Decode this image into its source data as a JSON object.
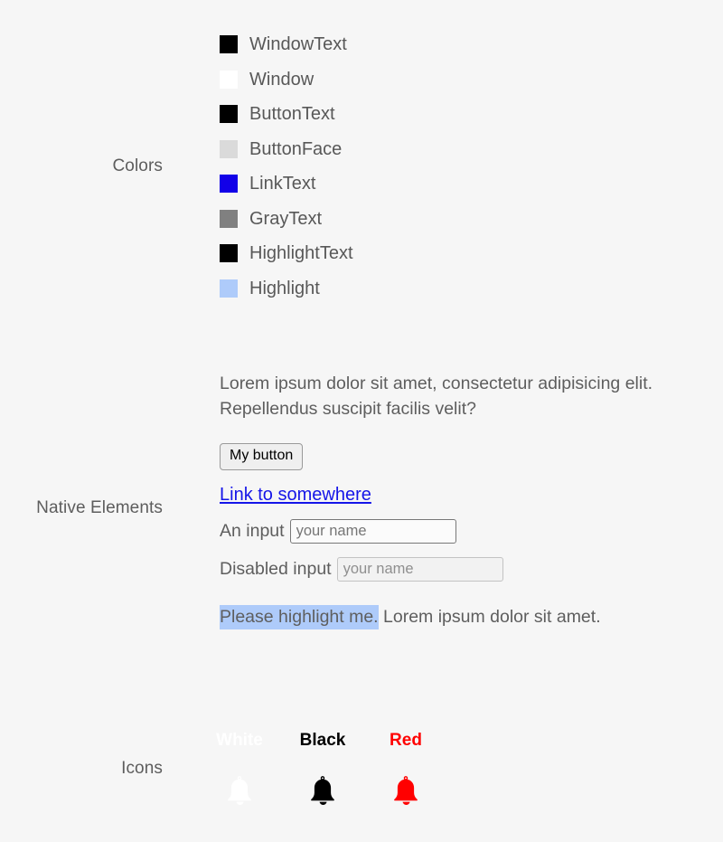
{
  "page": {
    "background": "#f6f6f6",
    "text_color": "#5a5a5a"
  },
  "colors": {
    "section_label": "Colors",
    "swatches": [
      {
        "name": "WindowText",
        "color": "#000000"
      },
      {
        "name": "Window",
        "color": "#ffffff"
      },
      {
        "name": "ButtonText",
        "color": "#000000"
      },
      {
        "name": "ButtonFace",
        "color": "#dadada"
      },
      {
        "name": "LinkText",
        "color": "#1200e8"
      },
      {
        "name": "GrayText",
        "color": "#808080"
      },
      {
        "name": "HighlightText",
        "color": "#000000"
      },
      {
        "name": "Highlight",
        "color": "#aecbfa"
      }
    ]
  },
  "native": {
    "section_label": "Native Elements",
    "paragraph": "Lorem ipsum dolor sit amet, consectetur adipisicing elit. Repellendus suscipit facilis velit?",
    "button_label": "My button",
    "link_label": "Link to somewhere",
    "input": {
      "label": "An input",
      "placeholder": "your name",
      "value": ""
    },
    "disabled_input": {
      "label": "Disabled input",
      "placeholder": "your name",
      "value": ""
    },
    "highlight_sentence": {
      "highlighted": "Please highlight me.",
      "rest": " Lorem ipsum dolor sit amet.",
      "highlight_color": "#aecbfa"
    }
  },
  "icons": {
    "section_label": "Icons",
    "items": [
      {
        "caption": "White",
        "color": "#ffffff",
        "icon": "bell-icon"
      },
      {
        "caption": "Black",
        "color": "#000000",
        "icon": "bell-icon"
      },
      {
        "caption": "Red",
        "color": "#ff0000",
        "icon": "bell-icon"
      }
    ]
  }
}
